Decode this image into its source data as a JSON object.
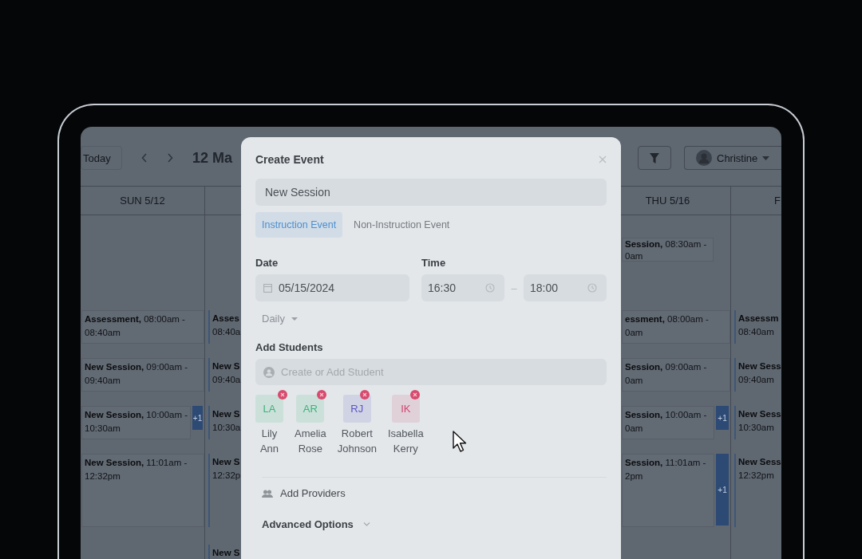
{
  "toolbar": {
    "today": "Today",
    "title": "12 Ma",
    "user": "Christine"
  },
  "columns": [
    {
      "header": "SUN 5/12",
      "events": [
        {
          "text": "**Assessment,** 08:00am -",
          "end": "08:40am"
        },
        {
          "text": "**New Session,** 09:00am -",
          "end": "09:40am"
        },
        {
          "text": "**New Session,** 10:00am -",
          "end": "10:30am",
          "more": "+1"
        },
        {
          "text": "**New Session,** 11:01am -",
          "end": "12:32pm"
        }
      ]
    },
    {
      "events": [
        {
          "text": "**Asses**",
          "end": "08:40a"
        },
        {
          "text": "**New S**",
          "end": "09:40a"
        },
        {
          "text": "**New S**",
          "end": "10:30a"
        },
        {
          "text": "**New S**",
          "end": "12:32p"
        },
        {
          "text": "**New S**"
        }
      ]
    },
    {
      "header": "THU 5/16",
      "early": [
        {
          "text": "**Session,** 08:30am -",
          "end": "0am"
        }
      ],
      "events": [
        {
          "text": "**essment,** 08:00am -",
          "end": "0am"
        },
        {
          "text": "**Session,** 09:00am -",
          "end": "0am"
        },
        {
          "text": "**Session,** 10:00am -",
          "end": "0am",
          "more": "+1"
        },
        {
          "text": "**Session,** 11:01am -",
          "end": "2pm",
          "more": "+1"
        }
      ]
    },
    {
      "header": "F",
      "events": [
        {
          "text": "**Assessm**",
          "end": "08:40am"
        },
        {
          "text": "**New Sess**",
          "end": "09:40am"
        },
        {
          "text": "**New Sess**",
          "end": "10:30am"
        },
        {
          "text": "**New Sess**",
          "end": "12:32pm"
        }
      ]
    }
  ],
  "modal": {
    "title": "Create Event",
    "name_field": {
      "value": "New Session"
    },
    "tabs": [
      {
        "label": "Instruction Event",
        "selected": true
      },
      {
        "label": "Non-Instruction Event",
        "selected": false
      }
    ],
    "date": {
      "label": "Date",
      "value": "05/15/2024"
    },
    "time": {
      "label": "Time",
      "start": "16:30",
      "separator": "–",
      "end": "18:00"
    },
    "repeat": {
      "value": "Daily"
    },
    "students": {
      "label": "Add Students",
      "placeholder": "Create or Add Student",
      "items": [
        {
          "initials": "LA",
          "name": "Lily Ann",
          "color": "#3bb37a"
        },
        {
          "initials": "AR",
          "name": "Amelia Rose",
          "color": "#3bb37a"
        },
        {
          "initials": "RJ",
          "name": "Robert Johnson",
          "color": "#5b55c4"
        },
        {
          "initials": "IK",
          "name": "Isabella Kerry",
          "color": "#cf4670"
        }
      ]
    },
    "providers": "Add Providers",
    "advanced": "Advanced Options"
  }
}
